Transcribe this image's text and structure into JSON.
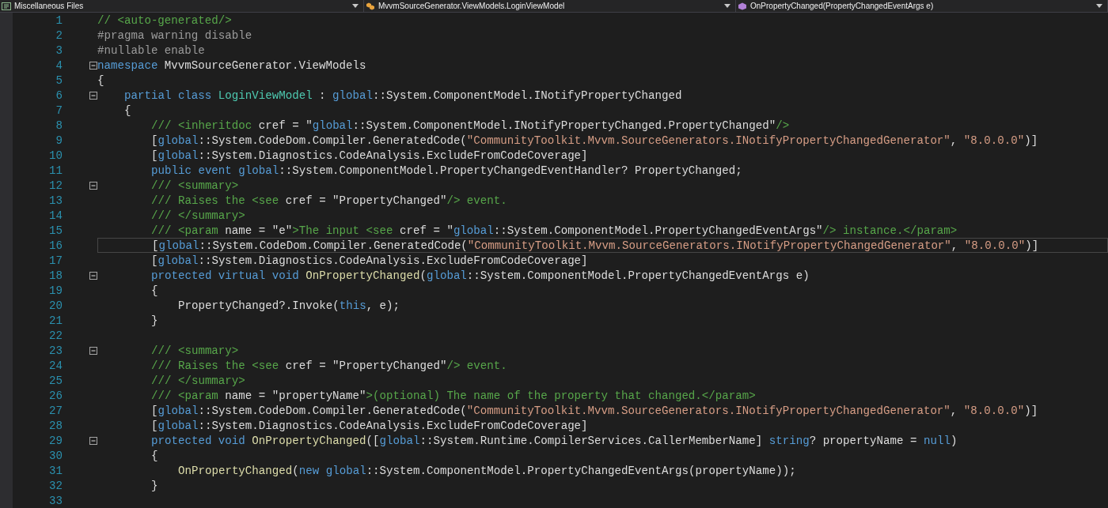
{
  "navigation_bar": [
    {
      "kind": "project",
      "label": "Miscellaneous Files"
    },
    {
      "kind": "class",
      "label": "MvvmSourceGenerator.ViewModels.LoginViewModel"
    },
    {
      "kind": "method",
      "label": "OnPropertyChanged(PropertyChangedEventArgs e)"
    }
  ],
  "lines": [
    {
      "number": "1",
      "foldable": false,
      "current": false,
      "tokens": [
        {
          "kind": "comment",
          "text": "// <auto-generated/>"
        }
      ]
    },
    {
      "number": "2",
      "foldable": false,
      "current": false,
      "tokens": [
        {
          "kind": "preproc",
          "text": "#pragma warning disable"
        }
      ]
    },
    {
      "number": "3",
      "foldable": false,
      "current": false,
      "tokens": [
        {
          "kind": "preproc",
          "text": "#nullable enable"
        }
      ]
    },
    {
      "number": "4",
      "foldable": true,
      "current": false,
      "tokens": [
        {
          "kind": "keyword",
          "text": "namespace"
        },
        {
          "kind": "plain",
          "text": " MvvmSourceGenerator.ViewModels"
        }
      ]
    },
    {
      "number": "5",
      "foldable": false,
      "current": false,
      "tokens": [
        {
          "kind": "plain",
          "text": "{"
        }
      ],
      "children": [
        {
          "number": "6",
          "foldable": true,
          "current": false,
          "tokens": [
            {
              "kind": "keyword",
              "text": "partial class"
            },
            {
              "kind": "type",
              "text": " LoginViewModel"
            },
            {
              "kind": "plain",
              "text": " : "
            },
            {
              "kind": "keyword",
              "text": "global"
            },
            {
              "kind": "plain",
              "text": "::System.ComponentModel.INotifyPropertyChanged"
            }
          ]
        },
        {
          "number": "7",
          "foldable": false,
          "current": false,
          "tokens": [
            {
              "kind": "plain",
              "text": "{"
            }
          ],
          "children": [
            {
              "number": "8",
              "foldable": false,
              "current": false,
              "tokens": [
                {
                  "kind": "doc",
                  "text": "/// <inheritdoc"
                },
                {
                  "kind": "plain",
                  "text": " cref = \""
                },
                {
                  "kind": "keyword",
                  "text": "global"
                },
                {
                  "kind": "plain",
                  "text": "::System.ComponentModel.INotifyPropertyChanged.PropertyChanged\""
                },
                {
                  "kind": "doc",
                  "text": "/>"
                }
              ]
            },
            {
              "number": "9",
              "foldable": false,
              "current": false,
              "tokens": [
                {
                  "kind": "plain",
                  "text": "["
                },
                {
                  "kind": "keyword",
                  "text": "global"
                },
                {
                  "kind": "plain",
                  "text": "::System.CodeDom.Compiler.GeneratedCode("
                },
                {
                  "kind": "string",
                  "text": "\"CommunityToolkit.Mvvm.SourceGenerators.INotifyPropertyChangedGenerator\""
                },
                {
                  "kind": "plain",
                  "text": ", "
                },
                {
                  "kind": "string",
                  "text": "\"8.0.0.0\""
                },
                {
                  "kind": "plain",
                  "text": ")]"
                }
              ]
            },
            {
              "number": "10",
              "foldable": false,
              "current": false,
              "tokens": [
                {
                  "kind": "plain",
                  "text": "["
                },
                {
                  "kind": "keyword",
                  "text": "global"
                },
                {
                  "kind": "plain",
                  "text": "::System.Diagnostics.CodeAnalysis.ExcludeFromCodeCoverage]"
                }
              ]
            },
            {
              "number": "11",
              "foldable": false,
              "current": false,
              "tokens": [
                {
                  "kind": "keyword",
                  "text": "public event global"
                },
                {
                  "kind": "plain",
                  "text": "::System.ComponentModel.PropertyChangedEventHandler? PropertyChanged;"
                }
              ]
            },
            {
              "number": "12",
              "foldable": true,
              "current": false,
              "tokens": [
                {
                  "kind": "doc",
                  "text": "/// <summary>"
                }
              ]
            },
            {
              "number": "13",
              "foldable": false,
              "current": false,
              "tokens": [
                {
                  "kind": "doc",
                  "text": "/// Raises the <see"
                },
                {
                  "kind": "plain",
                  "text": " cref = \"PropertyChanged\""
                },
                {
                  "kind": "doc",
                  "text": "/> event."
                }
              ]
            },
            {
              "number": "14",
              "foldable": false,
              "current": false,
              "tokens": [
                {
                  "kind": "doc",
                  "text": "/// </summary>"
                }
              ]
            },
            {
              "number": "15",
              "foldable": false,
              "current": false,
              "tokens": [
                {
                  "kind": "doc",
                  "text": "/// <param"
                },
                {
                  "kind": "plain",
                  "text": " name = \"e\""
                },
                {
                  "kind": "doc",
                  "text": ">The input <see"
                },
                {
                  "kind": "plain",
                  "text": " cref = \""
                },
                {
                  "kind": "keyword",
                  "text": "global"
                },
                {
                  "kind": "plain",
                  "text": "::System.ComponentModel.PropertyChangedEventArgs\""
                },
                {
                  "kind": "doc",
                  "text": "/> instance.</param>"
                }
              ]
            },
            {
              "number": "16",
              "foldable": false,
              "current": true,
              "tokens": [
                {
                  "kind": "plain",
                  "text": "["
                },
                {
                  "kind": "keyword",
                  "text": "global"
                },
                {
                  "kind": "plain",
                  "text": "::System.CodeDom.Compiler.GeneratedCode("
                },
                {
                  "kind": "string",
                  "text": "\"CommunityToolkit.Mvvm.SourceGenerators.INotifyPropertyChangedGenerator\""
                },
                {
                  "kind": "plain",
                  "text": ", "
                },
                {
                  "kind": "string",
                  "text": "\"8.0.0.0\""
                },
                {
                  "kind": "plain",
                  "text": ")]"
                }
              ]
            },
            {
              "number": "17",
              "foldable": false,
              "current": false,
              "tokens": [
                {
                  "kind": "plain",
                  "text": "["
                },
                {
                  "kind": "keyword",
                  "text": "global"
                },
                {
                  "kind": "plain",
                  "text": "::System.Diagnostics.CodeAnalysis.ExcludeFromCodeCoverage]"
                }
              ]
            },
            {
              "number": "18",
              "foldable": true,
              "current": false,
              "tokens": [
                {
                  "kind": "keyword",
                  "text": "protected virtual void"
                },
                {
                  "kind": "method",
                  "text": " OnPropertyChanged"
                },
                {
                  "kind": "plain",
                  "text": "("
                },
                {
                  "kind": "keyword",
                  "text": "global"
                },
                {
                  "kind": "plain",
                  "text": "::System.ComponentModel.PropertyChangedEventArgs e)"
                }
              ]
            },
            {
              "number": "19",
              "foldable": false,
              "current": false,
              "tokens": [
                {
                  "kind": "plain",
                  "text": "{"
                }
              ],
              "children": [
                {
                  "number": "20",
                  "foldable": false,
                  "current": false,
                  "tokens": [
                    {
                      "kind": "plain",
                      "text": "PropertyChanged?.Invoke("
                    },
                    {
                      "kind": "keyword",
                      "text": "this"
                    },
                    {
                      "kind": "plain",
                      "text": ", e);"
                    }
                  ]
                }
              ]
            },
            {
              "number": "21",
              "foldable": false,
              "current": false,
              "tokens": [
                {
                  "kind": "plain",
                  "text": "}"
                }
              ]
            },
            {
              "number": "22",
              "foldable": false,
              "current": false
            },
            {
              "number": "23",
              "foldable": true,
              "current": false,
              "tokens": [
                {
                  "kind": "doc",
                  "text": "/// <summary>"
                }
              ]
            },
            {
              "number": "24",
              "foldable": false,
              "current": false,
              "tokens": [
                {
                  "kind": "doc",
                  "text": "/// Raises the <see"
                },
                {
                  "kind": "plain",
                  "text": " cref = \"PropertyChanged\""
                },
                {
                  "kind": "doc",
                  "text": "/> event."
                }
              ]
            },
            {
              "number": "25",
              "foldable": false,
              "current": false,
              "tokens": [
                {
                  "kind": "doc",
                  "text": "/// </summary>"
                }
              ]
            },
            {
              "number": "26",
              "foldable": false,
              "current": false,
              "tokens": [
                {
                  "kind": "doc",
                  "text": "/// <param"
                },
                {
                  "kind": "plain",
                  "text": " name = \"propertyName\""
                },
                {
                  "kind": "doc",
                  "text": ">(optional) The name of the property that changed.</param>"
                }
              ]
            },
            {
              "number": "27",
              "foldable": false,
              "current": false,
              "tokens": [
                {
                  "kind": "plain",
                  "text": "["
                },
                {
                  "kind": "keyword",
                  "text": "global"
                },
                {
                  "kind": "plain",
                  "text": "::System.CodeDom.Compiler.GeneratedCode("
                },
                {
                  "kind": "string",
                  "text": "\"CommunityToolkit.Mvvm.SourceGenerators.INotifyPropertyChangedGenerator\""
                },
                {
                  "kind": "plain",
                  "text": ", "
                },
                {
                  "kind": "string",
                  "text": "\"8.0.0.0\""
                },
                {
                  "kind": "plain",
                  "text": ")]"
                }
              ]
            },
            {
              "number": "28",
              "foldable": false,
              "current": false,
              "tokens": [
                {
                  "kind": "plain",
                  "text": "["
                },
                {
                  "kind": "keyword",
                  "text": "global"
                },
                {
                  "kind": "plain",
                  "text": "::System.Diagnostics.CodeAnalysis.ExcludeFromCodeCoverage]"
                }
              ]
            },
            {
              "number": "29",
              "foldable": true,
              "current": false,
              "tokens": [
                {
                  "kind": "keyword",
                  "text": "protected void"
                },
                {
                  "kind": "method",
                  "text": " OnPropertyChanged"
                },
                {
                  "kind": "plain",
                  "text": "(["
                },
                {
                  "kind": "keyword",
                  "text": "global"
                },
                {
                  "kind": "plain",
                  "text": "::System.Runtime.CompilerServices.CallerMemberName] "
                },
                {
                  "kind": "keyword",
                  "text": "string"
                },
                {
                  "kind": "plain",
                  "text": "? propertyName = "
                },
                {
                  "kind": "keyword",
                  "text": "null"
                },
                {
                  "kind": "plain",
                  "text": ")"
                }
              ]
            },
            {
              "number": "30",
              "foldable": false,
              "current": false,
              "tokens": [
                {
                  "kind": "plain",
                  "text": "{"
                }
              ],
              "children": [
                {
                  "number": "31",
                  "foldable": false,
                  "current": false,
                  "tokens": [
                    {
                      "kind": "method",
                      "text": "OnPropertyChanged"
                    },
                    {
                      "kind": "plain",
                      "text": "("
                    },
                    {
                      "kind": "keyword",
                      "text": "new global"
                    },
                    {
                      "kind": "plain",
                      "text": "::System.ComponentModel.PropertyChangedEventArgs(propertyName));"
                    }
                  ]
                }
              ]
            },
            {
              "number": "32",
              "foldable": false,
              "current": false,
              "tokens": [
                {
                  "kind": "plain",
                  "text": "}"
                }
              ]
            },
            {
              "number": "33",
              "foldable": false,
              "current": false
            }
          ]
        }
      ]
    }
  ]
}
